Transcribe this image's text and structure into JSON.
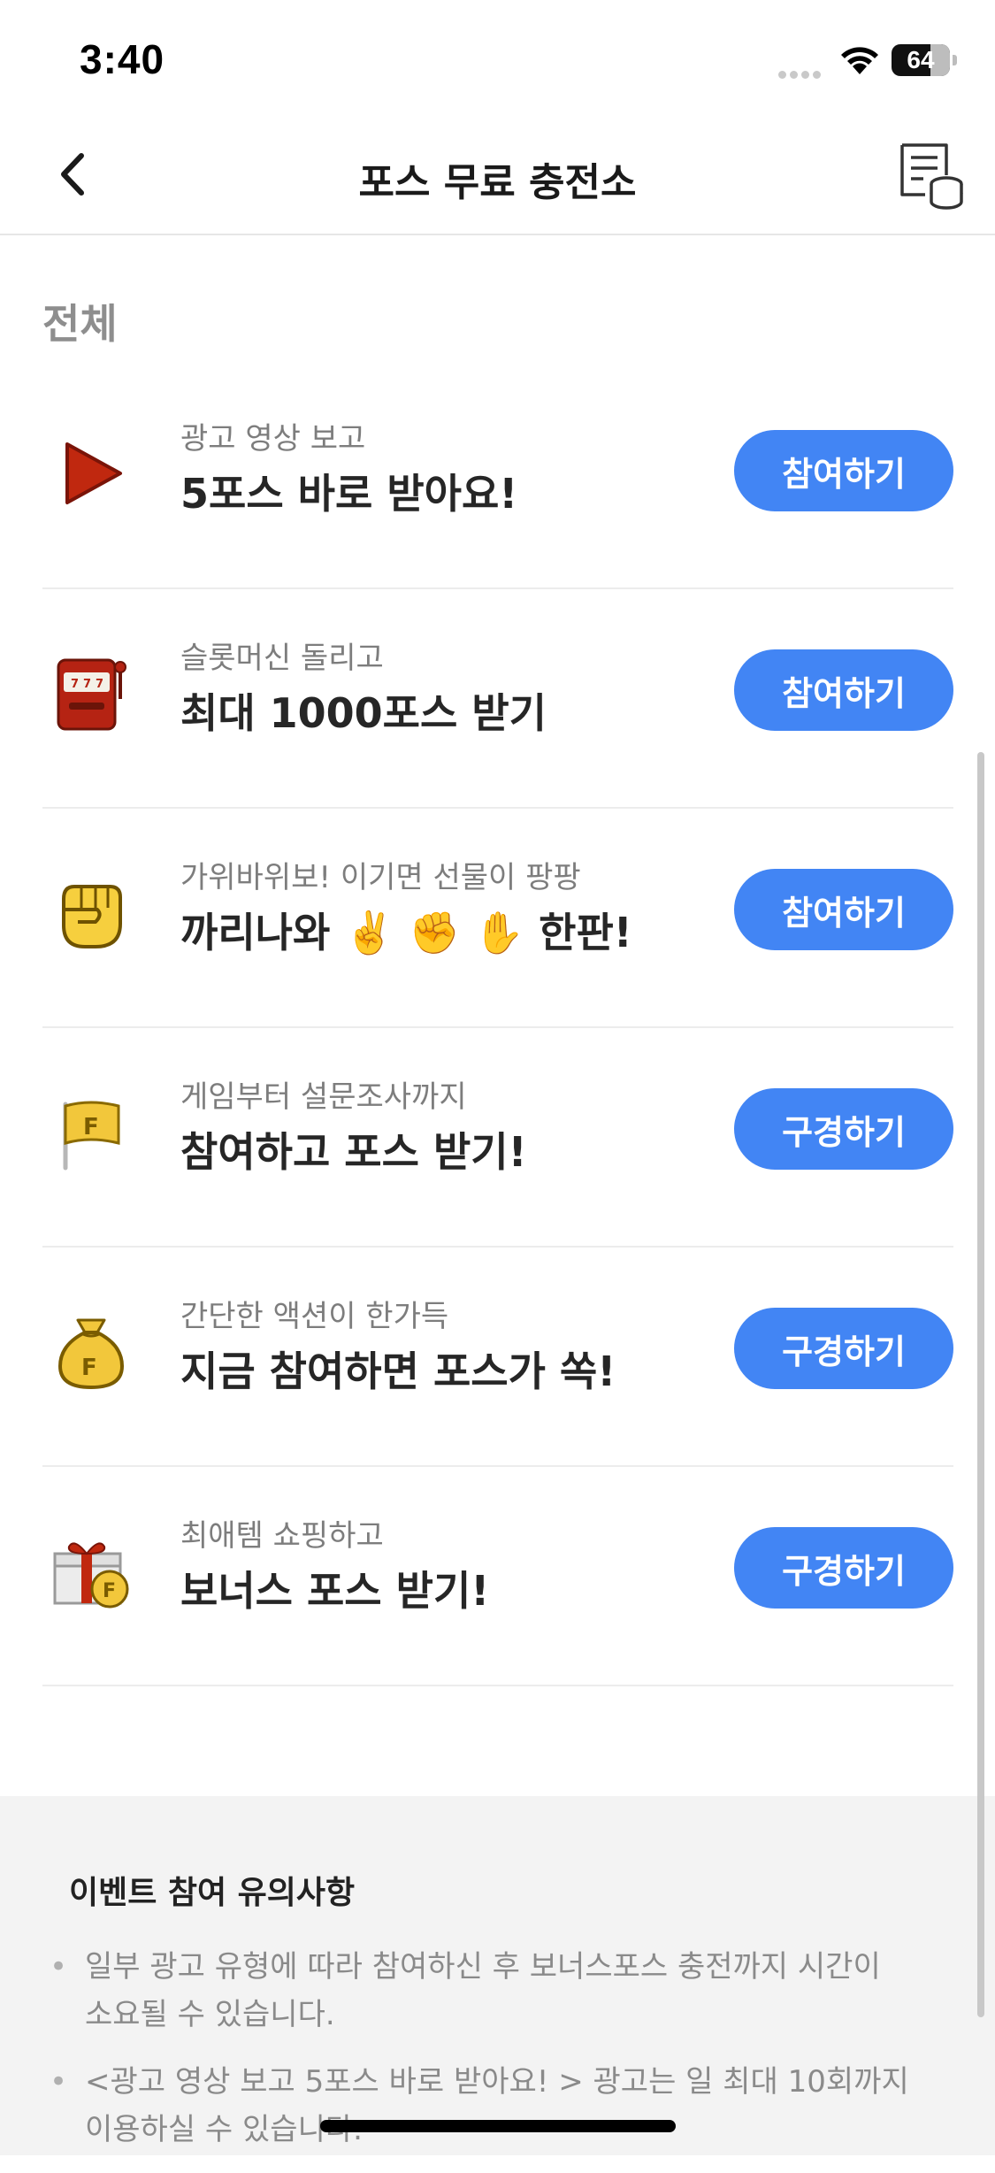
{
  "status": {
    "time": "3:40",
    "battery": "64"
  },
  "nav": {
    "title": "포스 무료 충전소",
    "back_icon": "chevron-left-icon",
    "history_icon": "receipt-coins-icon"
  },
  "section": {
    "title": "전체"
  },
  "items": [
    {
      "subtitle": "광고 영상 보고",
      "title": "5포스 바로 받아요!",
      "button": "참여하기",
      "icon": "play-icon"
    },
    {
      "subtitle": "슬롯머신 돌리고",
      "title": "최대 1000포스 받기",
      "button": "참여하기",
      "icon": "slot-machine-icon"
    },
    {
      "subtitle": "가위바위보! 이기면 선물이 팡팡",
      "title": "까리나와 ✌️ ✊ ✋ 한판!",
      "button": "참여하기",
      "icon": "fist-icon"
    },
    {
      "subtitle": "게임부터 설문조사까지",
      "title": "참여하고 포스 받기!",
      "button": "구경하기",
      "icon": "flag-icon"
    },
    {
      "subtitle": "간단한 액션이 한가득",
      "title": "지금 참여하면 포스가 쏙!",
      "button": "구경하기",
      "icon": "money-bag-icon"
    },
    {
      "subtitle": "최애템 쇼핑하고",
      "title": "보너스 포스 받기!",
      "button": "구경하기",
      "icon": "gift-coin-icon"
    }
  ],
  "notice": {
    "title": "이벤트 참여 유의사항",
    "items": [
      "일부 광고 유형에 따라 참여하신 후 보너스포스 충전까지 시간이 소요될 수 있습니다.",
      "<광고 영상 보고 5포스 바로 받아요! > 광고는 일 최대 10회까지 이용하실 수 있습니다."
    ]
  },
  "colors": {
    "accent": "#4285f4",
    "icon_red": "#b81f0e",
    "icon_yellow": "#f2c73b"
  }
}
